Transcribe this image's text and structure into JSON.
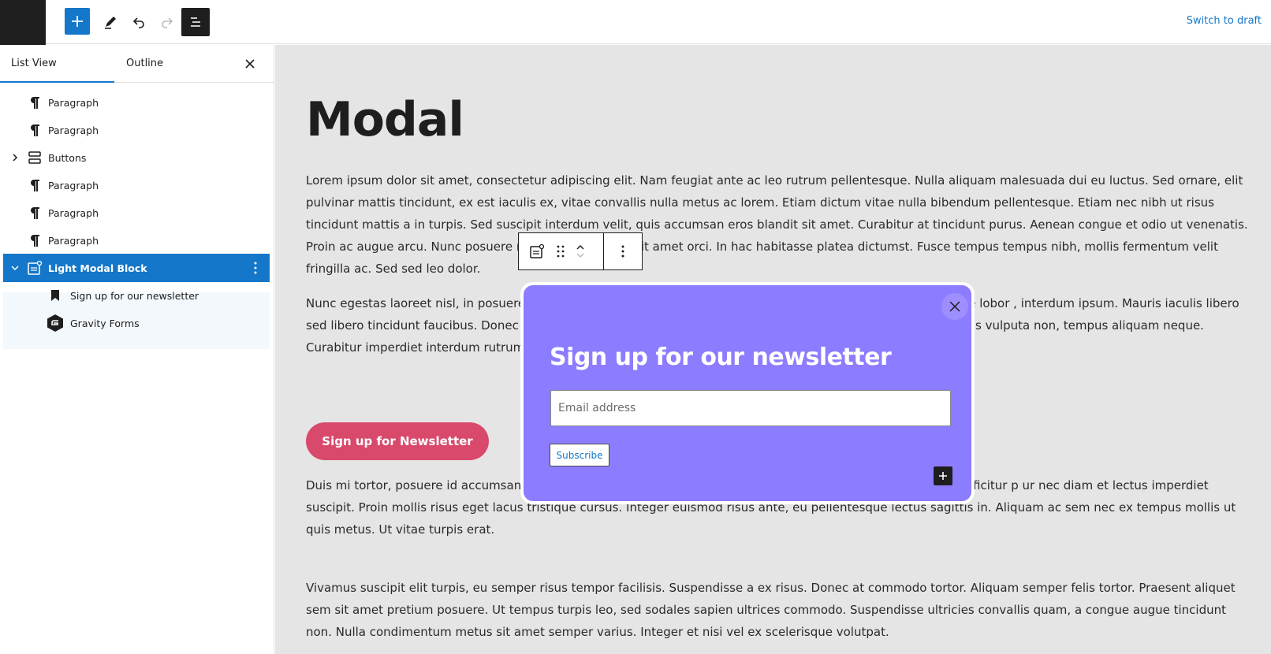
{
  "topbar": {
    "switch_draft": "Switch to draft"
  },
  "sidebar": {
    "tabs": [
      {
        "label": "List View",
        "active": true
      },
      {
        "label": "Outline",
        "active": false
      }
    ],
    "items": [
      {
        "label": "Paragraph",
        "icon": "paragraph-icon"
      },
      {
        "label": "Paragraph",
        "icon": "paragraph-icon"
      },
      {
        "label": "Buttons",
        "icon": "buttons-icon",
        "expandable": true
      },
      {
        "label": "Paragraph",
        "icon": "paragraph-icon"
      },
      {
        "label": "Paragraph",
        "icon": "paragraph-icon"
      },
      {
        "label": "Paragraph",
        "icon": "paragraph-icon"
      },
      {
        "label": "Light Modal Block",
        "icon": "modal-block-icon",
        "selected": true,
        "expanded": true
      },
      {
        "label": "Sign up for our newsletter",
        "icon": "bookmark-icon",
        "child": true
      },
      {
        "label": "Gravity Forms",
        "icon": "gravity-forms-icon",
        "child": true
      }
    ]
  },
  "canvas": {
    "title": "Modal",
    "paragraphs": [
      "Lorem ipsum dolor sit amet, consectetur adipiscing elit. Nam feugiat ante ac leo rutrum pellentesque. Nulla aliquam malesuada dui eu luctus. Sed ornare, elit pulvinar mattis tincidunt, ex est iaculis ex, vitae convallis nulla metus ac lorem. Etiam dictum vitae nulla bibendum pellentesque. Etiam nec nibh ut risus tincidunt mattis a in turpis. Sed suscipit interdum velit, quis accumsan eros blandit sit amet. Curabitur at tincidunt purus. Aenean congue et odio ut venenatis. Proin ac augue arcu. Nunc posuere magna sed turpis                 n sit amet orci. In hac habitasse platea dictumst. Fusce tempus tempus nibh, mollis fermentum velit fringilla ac. Sed sed leo dolor.",
      "Nunc egestas laoreet nisl, in posuere r                                                                                                                                     bulum semper. Proin sollicitudin lectus ut eleifend rhoncus. Ut eget augue lobor                                                                                                                         , interdum ipsum. Mauris iaculis libero sed libero tincidunt faucibus. Donec nisl se                                                                                                                celerisque ipsum ut, cursus nulla. Nulla maximus neque ac orci finibus vulputa                                                                                                                   non, tempus aliquam neque. Curabitur imperdiet interdum rutrum.",
      "Duis mi tortor, posuere id accumsan id                                                                                                                                     ccumsan et sapien ut vestibulum. Quisque ullamcorper hendrerit nulla efficitur p                                                                                                                        ur nec diam et lectus imperdiet suscipit. Proin mollis risus eget lacus tristique cursus. Integer euismod risus ante, eu pellentesque lectus sagittis in. Aliquam ac sem nec ex tempus mollis ut quis metus. Ut vitae turpis erat.",
      "Vivamus suscipit elit turpis, eu semper risus tempor facilisis. Suspendisse a ex risus. Donec at commodo tortor. Aliquam semper felis tortor. Praesent aliquet sem sit amet pretium posuere. Ut tempus turpis leo, sed sodales sapien ultrices commodo. Suspendisse ultricies convallis quam, a congue augue tincidunt non. Nulla condimentum metus sit amet semper varius. Integer et nisi vel ex scelerisque volutpat."
    ],
    "newsletter_button": "Sign up for Newsletter"
  },
  "modal": {
    "title": "Sign up for our newsletter",
    "email_placeholder": "Email address",
    "subscribe_label": "Subscribe",
    "background_color": "#8c7cff"
  },
  "colors": {
    "accent": "#1477c9",
    "newsletter_button": "#d9496b"
  }
}
